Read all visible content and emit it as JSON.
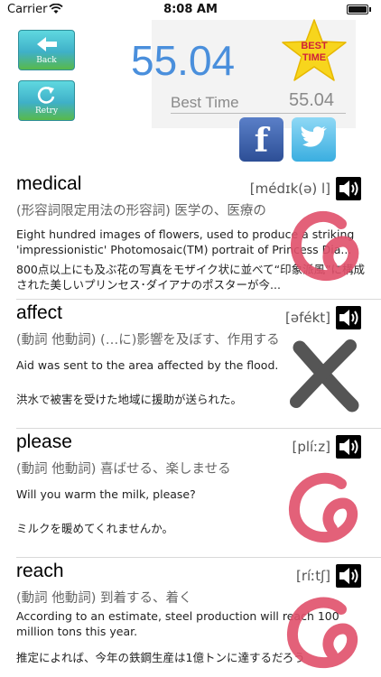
{
  "status": {
    "carrier": "Carrier",
    "time": "8:08 AM"
  },
  "nav": {
    "back_label": "Back",
    "retry_label": "Retry"
  },
  "score": {
    "time": "55.04",
    "best_label": "Best Time",
    "best_value": "55.04",
    "badge_line1": "BEST",
    "badge_line2": "TIME"
  },
  "entries": [
    {
      "word": "medical",
      "pron": "[médɪk(ə) l]",
      "pos": "(形容詞限定用法の形容詞) 医学の、医療の",
      "example_en": "Eight hundred images of flowers, used to produce a striking 'impressionistic' Photomosaic(TM) portrait of Princess Dia...",
      "example_ja": "800点以上にも及ぶ花の写真をモザイク状に並べて“印象派風”に構成された美しいプリンセス･ダイアナのポスターが今...",
      "mark": "correct"
    },
    {
      "word": "affect",
      "pron": "[əfékt]",
      "pos": "(動詞 他動詞) (…に)影響を及ぼす、作用する",
      "example_en": "Aid was sent to the area affected by the flood.",
      "example_ja": "洪水で被害を受けた地域に援助が送られた。",
      "mark": "wrong"
    },
    {
      "word": "please",
      "pron": "[plíːz]",
      "pos": "(動詞 他動詞) 喜ばせる、楽しませる",
      "example_en": "Will you warm the milk, please?",
      "example_ja": "ミルクを暖めてくれませんか。",
      "mark": "correct"
    },
    {
      "word": "reach",
      "pron": "[ríːtʃ]",
      "pos": "(動詞 他動詞) 到着する、着く",
      "example_en": "According to an estimate, steel production will reach 100 million tons this year.",
      "example_ja": "推定によれば、今年の鉄鋼生産は1億トンに達するだろう",
      "mark": "correct"
    }
  ],
  "colors": {
    "time": "#4a8fdc",
    "mark_correct": "#e0506a",
    "mark_wrong": "#555555"
  }
}
